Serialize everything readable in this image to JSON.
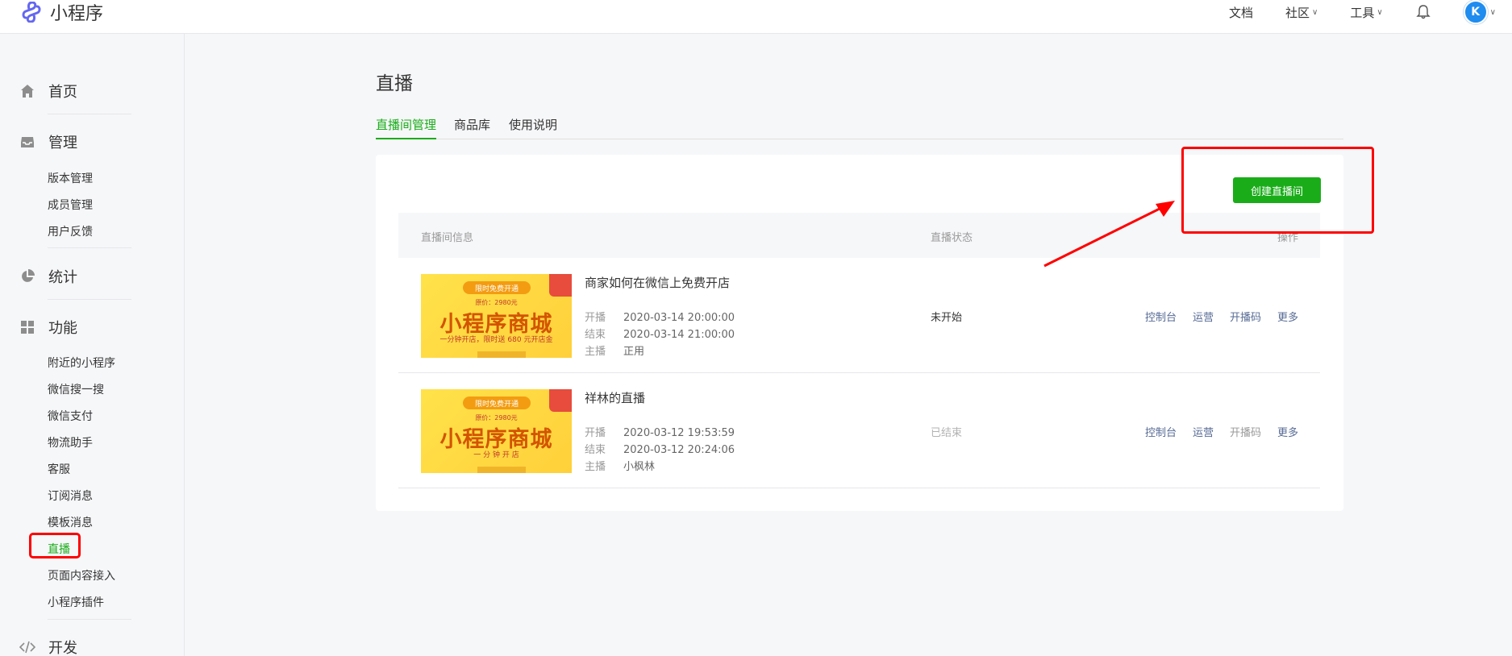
{
  "app": {
    "title": "小程序"
  },
  "topnav": {
    "docs": "文档",
    "community": "社区",
    "tools": "工具",
    "avatar_text": "K"
  },
  "sidebar": {
    "home": "首页",
    "manage": {
      "label": "管理",
      "items": [
        "版本管理",
        "成员管理",
        "用户反馈"
      ]
    },
    "stats": "统计",
    "features": {
      "label": "功能",
      "items": [
        "附近的小程序",
        "微信搜一搜",
        "微信支付",
        "物流助手",
        "客服",
        "订阅消息",
        "模板消息",
        "直播",
        "页面内容接入",
        "小程序插件"
      ]
    },
    "dev": "开发",
    "active_item": "直播"
  },
  "page": {
    "title": "直播",
    "tabs": [
      "直播间管理",
      "商品库",
      "使用说明"
    ],
    "create_button": "创建直播间",
    "table": {
      "headers": {
        "info": "直播间信息",
        "status": "直播状态",
        "ops": "操作"
      },
      "rows": [
        {
          "title": "商家如何在微信上免费开店",
          "start_label": "开播",
          "start": "2020-03-14 20:00:00",
          "end_label": "结束",
          "end": "2020-03-14 21:00:00",
          "host_label": "主播",
          "host": "正用",
          "status": "未开始",
          "cover": {
            "pill": "限时免费开通",
            "price": "原价：2980元",
            "title": "小程序商城",
            "slogan": "一分钟开店，限时送 680 元开店金"
          },
          "ops": [
            "控制台",
            "运营",
            "开播码",
            "更多"
          ]
        },
        {
          "title": "祥林的直播",
          "start_label": "开播",
          "start": "2020-03-12 19:53:59",
          "end_label": "结束",
          "end": "2020-03-12 20:24:06",
          "host_label": "主播",
          "host": "小枫林",
          "status": "已结束",
          "cover": {
            "pill": "限时免费开通",
            "price": "原价：2980元",
            "title": "小程序商城",
            "slogan": "一 分 钟 开 店"
          },
          "ops": [
            "控制台",
            "运营",
            "开播码",
            "更多"
          ]
        }
      ]
    }
  },
  "colors": {
    "accent": "#1aad19",
    "link": "#576b95",
    "annotation": "#ff0000"
  }
}
